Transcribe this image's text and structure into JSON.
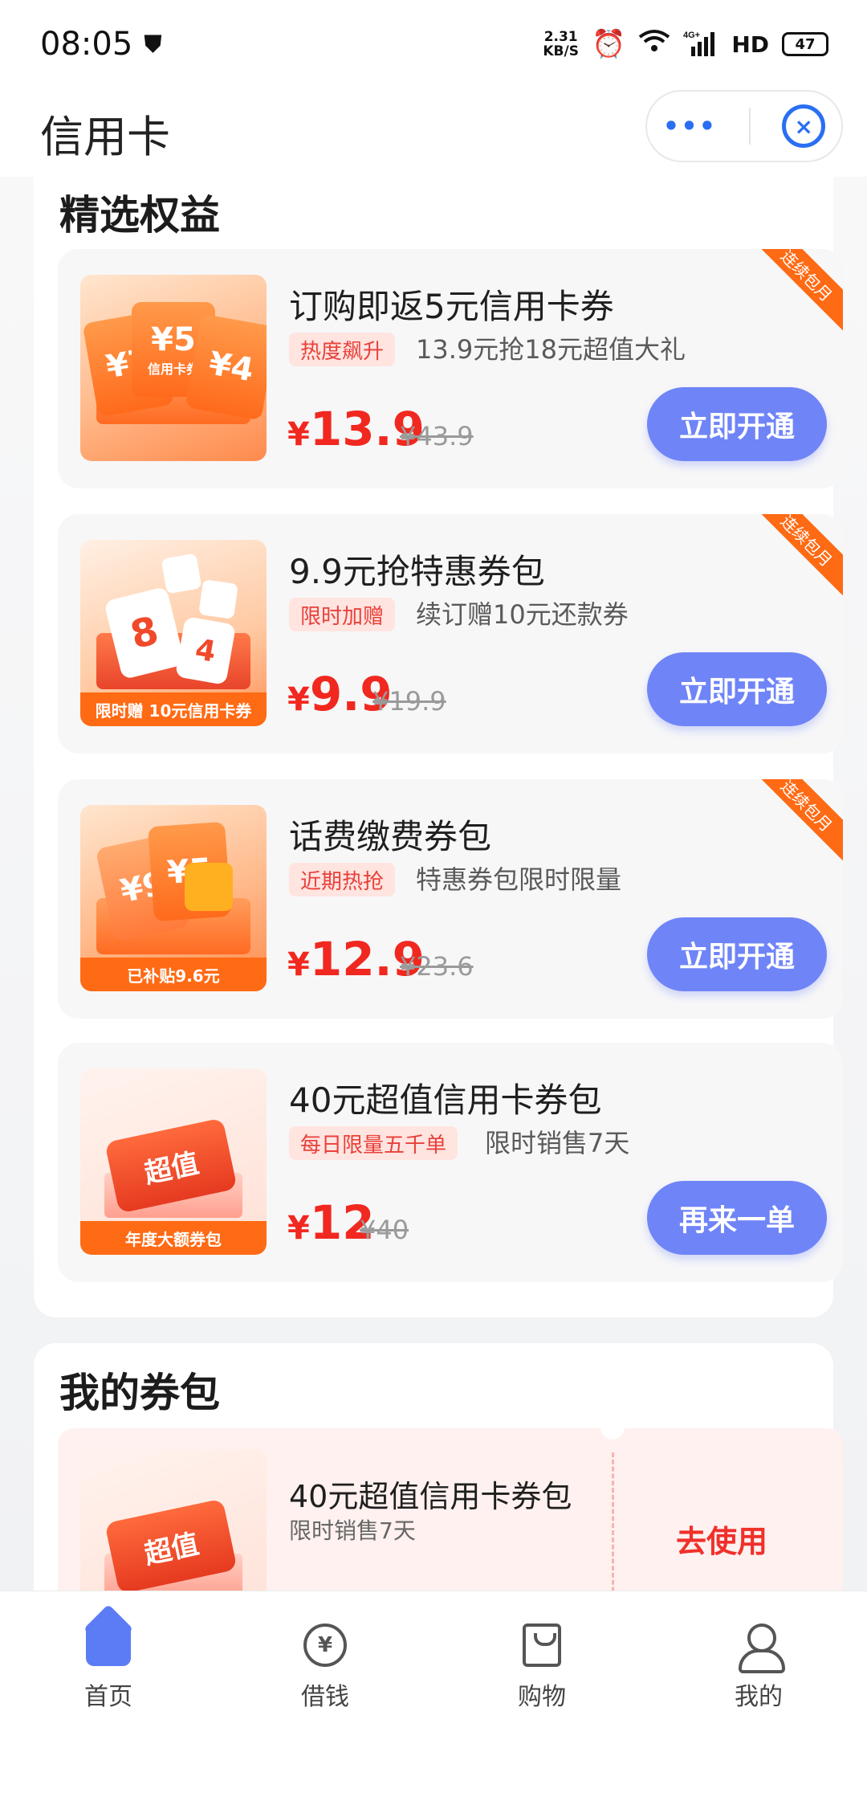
{
  "status": {
    "time": "08:05",
    "speed_top": "2.31",
    "speed_bottom": "KB/S",
    "battery": "47",
    "hd": "HD",
    "network": "4G+"
  },
  "header": {
    "title": "信用卡",
    "more": "•••",
    "close": "×"
  },
  "featured": {
    "title": "精选权益",
    "items": [
      {
        "name": "订购即返5元信用卡券",
        "tag": "热度飙升",
        "desc": "13.9元抢18元超值大礼",
        "currency": "¥",
        "price": "13.9",
        "old_price": "¥43.9",
        "button": "立即开通",
        "ribbon": "连续包月",
        "thumb_values": [
          "¥7",
          "¥5",
          "¥4"
        ],
        "thumb_label": "信用卡券"
      },
      {
        "name": "9.9元抢特惠券包",
        "tag": "限时加赠",
        "desc": "续订赠10元还款券",
        "currency": "¥",
        "price": "9.9",
        "old_price": "¥19.9",
        "button": "立即开通",
        "ribbon": "连续包月",
        "thumb_values": [
          "8",
          "4"
        ],
        "thumb_band": "限时赠 10元信用卡券"
      },
      {
        "name": "话费缴费券包",
        "tag": "近期热抢",
        "desc": "特惠券包限时限量",
        "currency": "¥",
        "price": "12.9",
        "old_price": "¥23.6",
        "button": "立即开通",
        "ribbon": "连续包月",
        "thumb_values": [
          "¥9",
          "¥5"
        ],
        "thumb_band": "已补贴9.6元"
      },
      {
        "name": "40元超值信用卡券包",
        "tag": "每日限量五千单",
        "desc": "限时销售7天",
        "currency": "¥",
        "price": "12",
        "old_price": "¥40",
        "button": "再来一单",
        "thumb_text": "超值",
        "thumb_band": "年度大额券包"
      }
    ]
  },
  "wallet": {
    "title": "我的券包",
    "item": {
      "name": "40元超值信用卡券包",
      "desc": "限时销售7天",
      "action": "去使用",
      "thumb_text": "超值"
    }
  },
  "tabbar": [
    {
      "label": "首页",
      "icon": "home-icon",
      "active": true
    },
    {
      "label": "借钱",
      "icon": "yuan-icon",
      "symbol": "¥"
    },
    {
      "label": "购物",
      "icon": "shopping-bag-icon"
    },
    {
      "label": "我的",
      "icon": "user-icon"
    }
  ],
  "colors": {
    "accent_blue": "#6f84f7",
    "price_red": "#f1281f",
    "ribbon_orange": "#ff6a14",
    "tag_bg": "#ffe4e0"
  }
}
